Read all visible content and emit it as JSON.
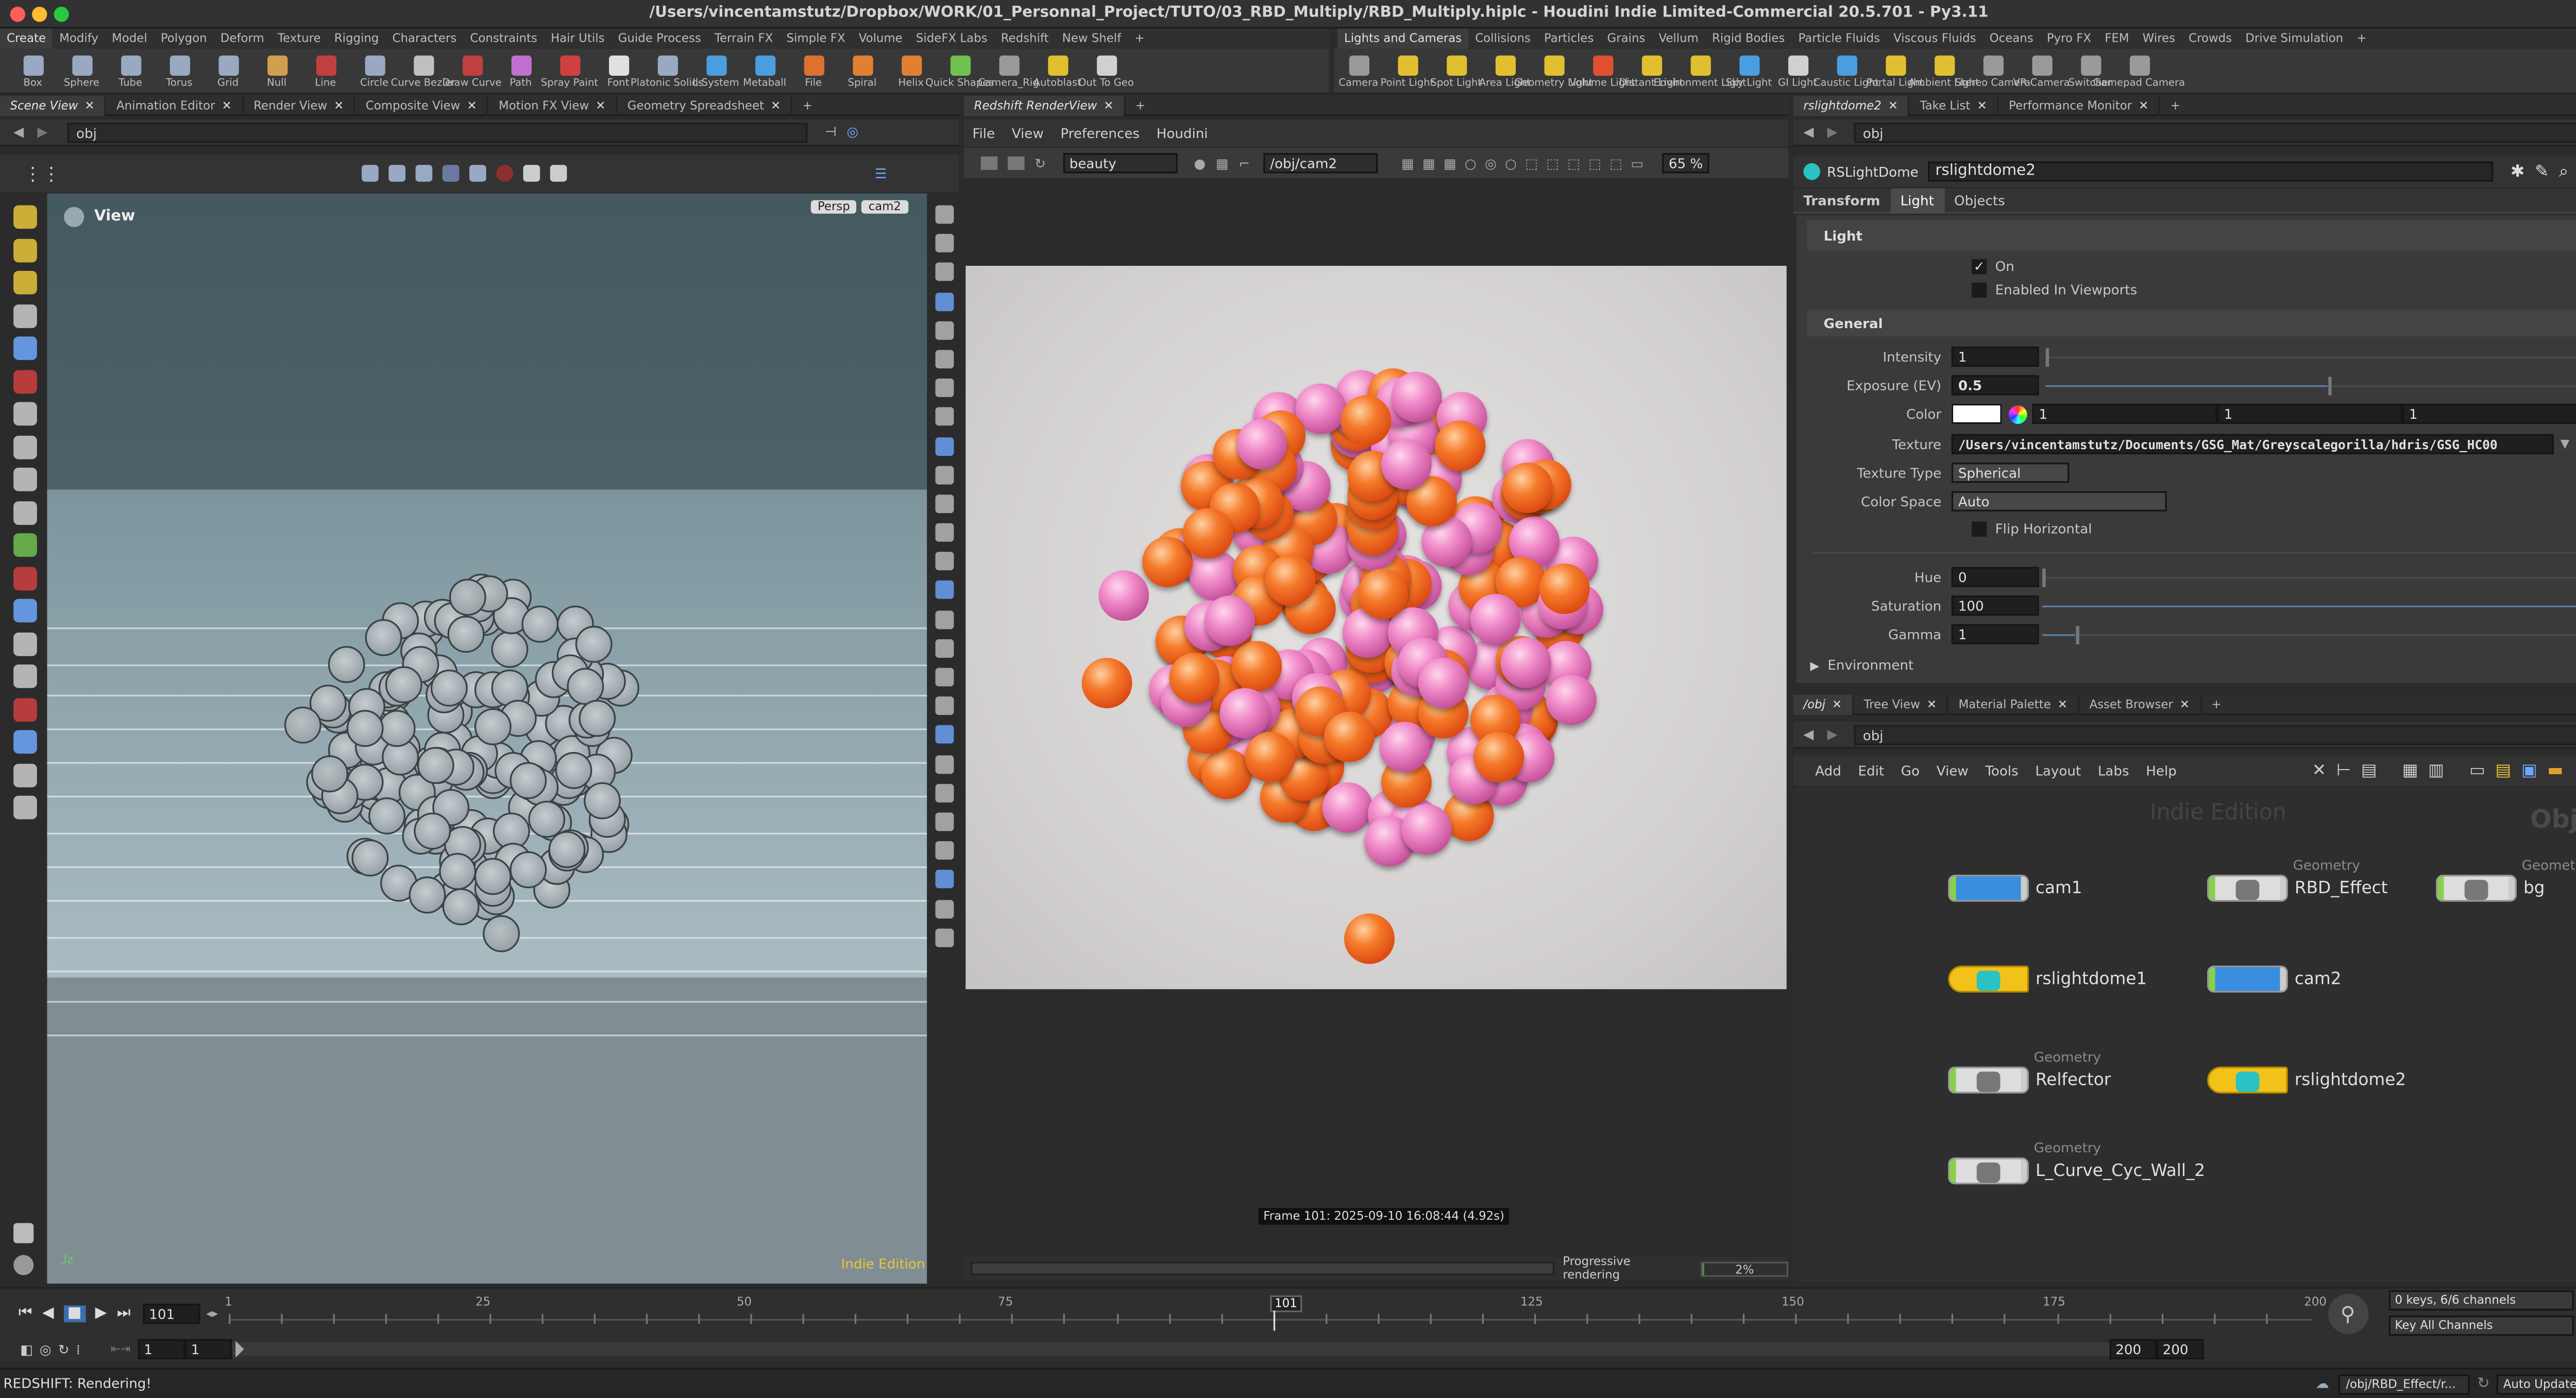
{
  "window": {
    "title": "/Users/vincentamstutz/Dropbox/WORK/01_Personnal_Project/TUTO/03_RBD_Multiply/RBD_Multiply.hiplc - Houdini Indie Limited-Commercial 20.5.701 - Py3.11"
  },
  "shelf_tabs_left": [
    "Create",
    "Modify",
    "Model",
    "Polygon",
    "Deform",
    "Texture",
    "Rigging",
    "Characters",
    "Constraints",
    "Hair Utils",
    "Guide Process",
    "Terrain FX",
    "Simple FX",
    "Volume",
    "SideFX Labs",
    "Redshift",
    "New Shelf"
  ],
  "shelf_tabs_right": [
    "Lights and Cameras",
    "Collisions",
    "Particles",
    "Grains",
    "Vellum",
    "Rigid Bodies",
    "Particle Fluids",
    "Viscous Fluids",
    "Oceans",
    "Pyro FX",
    "FEM",
    "Wires",
    "Crowds",
    "Drive Simulation"
  ],
  "tools_left": [
    {
      "label": "Box",
      "color": "#9aa9c2"
    },
    {
      "label": "Sphere",
      "color": "#9aa9c2"
    },
    {
      "label": "Tube",
      "color": "#9aa9c2"
    },
    {
      "label": "Torus",
      "color": "#9aa9c2"
    },
    {
      "label": "Grid",
      "color": "#9aa9c2"
    },
    {
      "label": "Null",
      "color": "#d0a050"
    },
    {
      "label": "Line",
      "color": "#c04040"
    },
    {
      "label": "Circle",
      "color": "#9aa9c2"
    },
    {
      "label": "Curve Bezier",
      "color": "#c0c0c0"
    },
    {
      "label": "Draw Curve",
      "color": "#c04040"
    },
    {
      "label": "Path",
      "color": "#c070d0"
    },
    {
      "label": "Spray Paint",
      "color": "#d04040"
    },
    {
      "label": "Font",
      "color": "#e0e0e0"
    },
    {
      "label": "Platonic Solids",
      "color": "#9aa9c2"
    },
    {
      "label": "L-System",
      "color": "#4a9ee0"
    },
    {
      "label": "Metaball",
      "color": "#4a9ee0"
    },
    {
      "label": "File",
      "color": "#e07030"
    },
    {
      "label": "Spiral",
      "color": "#e08030"
    },
    {
      "label": "Helix",
      "color": "#e08030"
    },
    {
      "label": "Quick Shapes",
      "color": "#70c050"
    },
    {
      "label": "Camera_Rig",
      "color": "#9a9a9a"
    },
    {
      "label": "Autoblast",
      "color": "#e0c030"
    },
    {
      "label": "Out To Geo",
      "color": "#d0d0d0"
    }
  ],
  "tools_right": [
    {
      "label": "Camera",
      "color": "#9a9a9a"
    },
    {
      "label": "Point Light",
      "color": "#e0c030"
    },
    {
      "label": "Spot Light",
      "color": "#e0c030"
    },
    {
      "label": "Area Light",
      "color": "#e0c030"
    },
    {
      "label": "Geometry Light",
      "color": "#e0c030"
    },
    {
      "label": "Volume Light",
      "color": "#e05030"
    },
    {
      "label": "Distant Light",
      "color": "#e0c030"
    },
    {
      "label": "Environment Light",
      "color": "#e0c030"
    },
    {
      "label": "Sky Light",
      "color": "#4a9ee0"
    },
    {
      "label": "GI Light",
      "color": "#d0d0d0"
    },
    {
      "label": "Caustic Light",
      "color": "#4a9ee0"
    },
    {
      "label": "Portal Light",
      "color": "#e0c030"
    },
    {
      "label": "Ambient Light",
      "color": "#e0c030"
    },
    {
      "label": "Stereo Camera",
      "color": "#9a9a9a"
    },
    {
      "label": "VR Camera",
      "color": "#9a9a9a"
    },
    {
      "label": "Switcher",
      "color": "#9a9a9a"
    },
    {
      "label": "Gamepad Camera",
      "color": "#9a9a9a"
    }
  ],
  "left_pane": {
    "tabs": [
      "Scene View",
      "Animation Editor",
      "Render View",
      "Composite View",
      "Motion FX View",
      "Geometry Spreadsheet"
    ],
    "path": "obj",
    "view_label": "View",
    "persp": "Persp",
    "cam": "cam2",
    "watermark": "Indie Edition"
  },
  "render_pane": {
    "tab": "Redshift RenderView",
    "menu": [
      "File",
      "View",
      "Preferences",
      "Houdini"
    ],
    "aov": "beauty",
    "camera": "/obj/cam2",
    "zoom": "65 %",
    "frame_info": "Frame 101: 2025-09-10 16:08:44 (4.92s)",
    "progress_label": "Progressive rendering",
    "progress_value": "2%",
    "progress": 0.02
  },
  "param_pane": {
    "tabs": [
      "rslightdome2",
      "Take List",
      "Performance Monitor"
    ],
    "path": "obj",
    "node_type": "RSLightDome",
    "node_name": "rslightdome2",
    "subtabs": [
      "Transform",
      "Light",
      "Objects"
    ],
    "section_light": "Light",
    "on_label": "On",
    "enabled_label": "Enabled In Viewports",
    "section_general": "General",
    "intensity_label": "Intensity",
    "intensity": "1",
    "exposure_label": "Exposure (EV)",
    "exposure": "0.5",
    "color_label": "Color",
    "color_r": "1",
    "color_g": "1",
    "color_b": "1",
    "texture_label": "Texture",
    "texture": "/Users/vincentamstutz/Documents/GSG_Mat/Greyscalegorilla/hdris/GSG_HC00",
    "texture_type_label": "Texture Type",
    "texture_type": "Spherical",
    "color_space_label": "Color Space",
    "color_space": "Auto",
    "flip_label": "Flip Horizontal",
    "hue_label": "Hue",
    "hue": "0",
    "saturation_label": "Saturation",
    "saturation": "100",
    "gamma_label": "Gamma",
    "gamma": "1",
    "environment_label": "Environment"
  },
  "network_pane": {
    "tabs": [
      "/obj",
      "Tree View",
      "Material Palette",
      "Asset Browser"
    ],
    "path": "obj",
    "menu": [
      "Add",
      "Edit",
      "Go",
      "View",
      "Tools",
      "Layout",
      "Labs",
      "Help"
    ],
    "watermark": "Indie Edition",
    "context": "Objects",
    "geometry_type": "Geometry",
    "nodes": [
      {
        "name": "cam1",
        "kind": "camera"
      },
      {
        "name": "RBD_Effect",
        "kind": "geo"
      },
      {
        "name": "bg",
        "kind": "geo"
      },
      {
        "name": "rslightdome1",
        "kind": "light"
      },
      {
        "name": "cam2",
        "kind": "camera"
      },
      {
        "name": "Relfector",
        "kind": "geo"
      },
      {
        "name": "rslightdome2",
        "kind": "light"
      },
      {
        "name": "L_Curve_Cyc_Wall_2",
        "kind": "geo"
      }
    ]
  },
  "timeline": {
    "frame": "101",
    "ticks": [
      "1",
      "25",
      "50",
      "75",
      "101",
      "125",
      "150",
      "175",
      "200"
    ],
    "start": "1",
    "start2": "1",
    "end": "200",
    "end2": "200",
    "keys_label": "0 keys, 6/6 channels",
    "key_all": "Key All Channels"
  },
  "status": {
    "message": "REDSHIFT: Rendering!",
    "path": "/obj/RBD_Effect/r...",
    "auto_update": "Auto Update"
  }
}
